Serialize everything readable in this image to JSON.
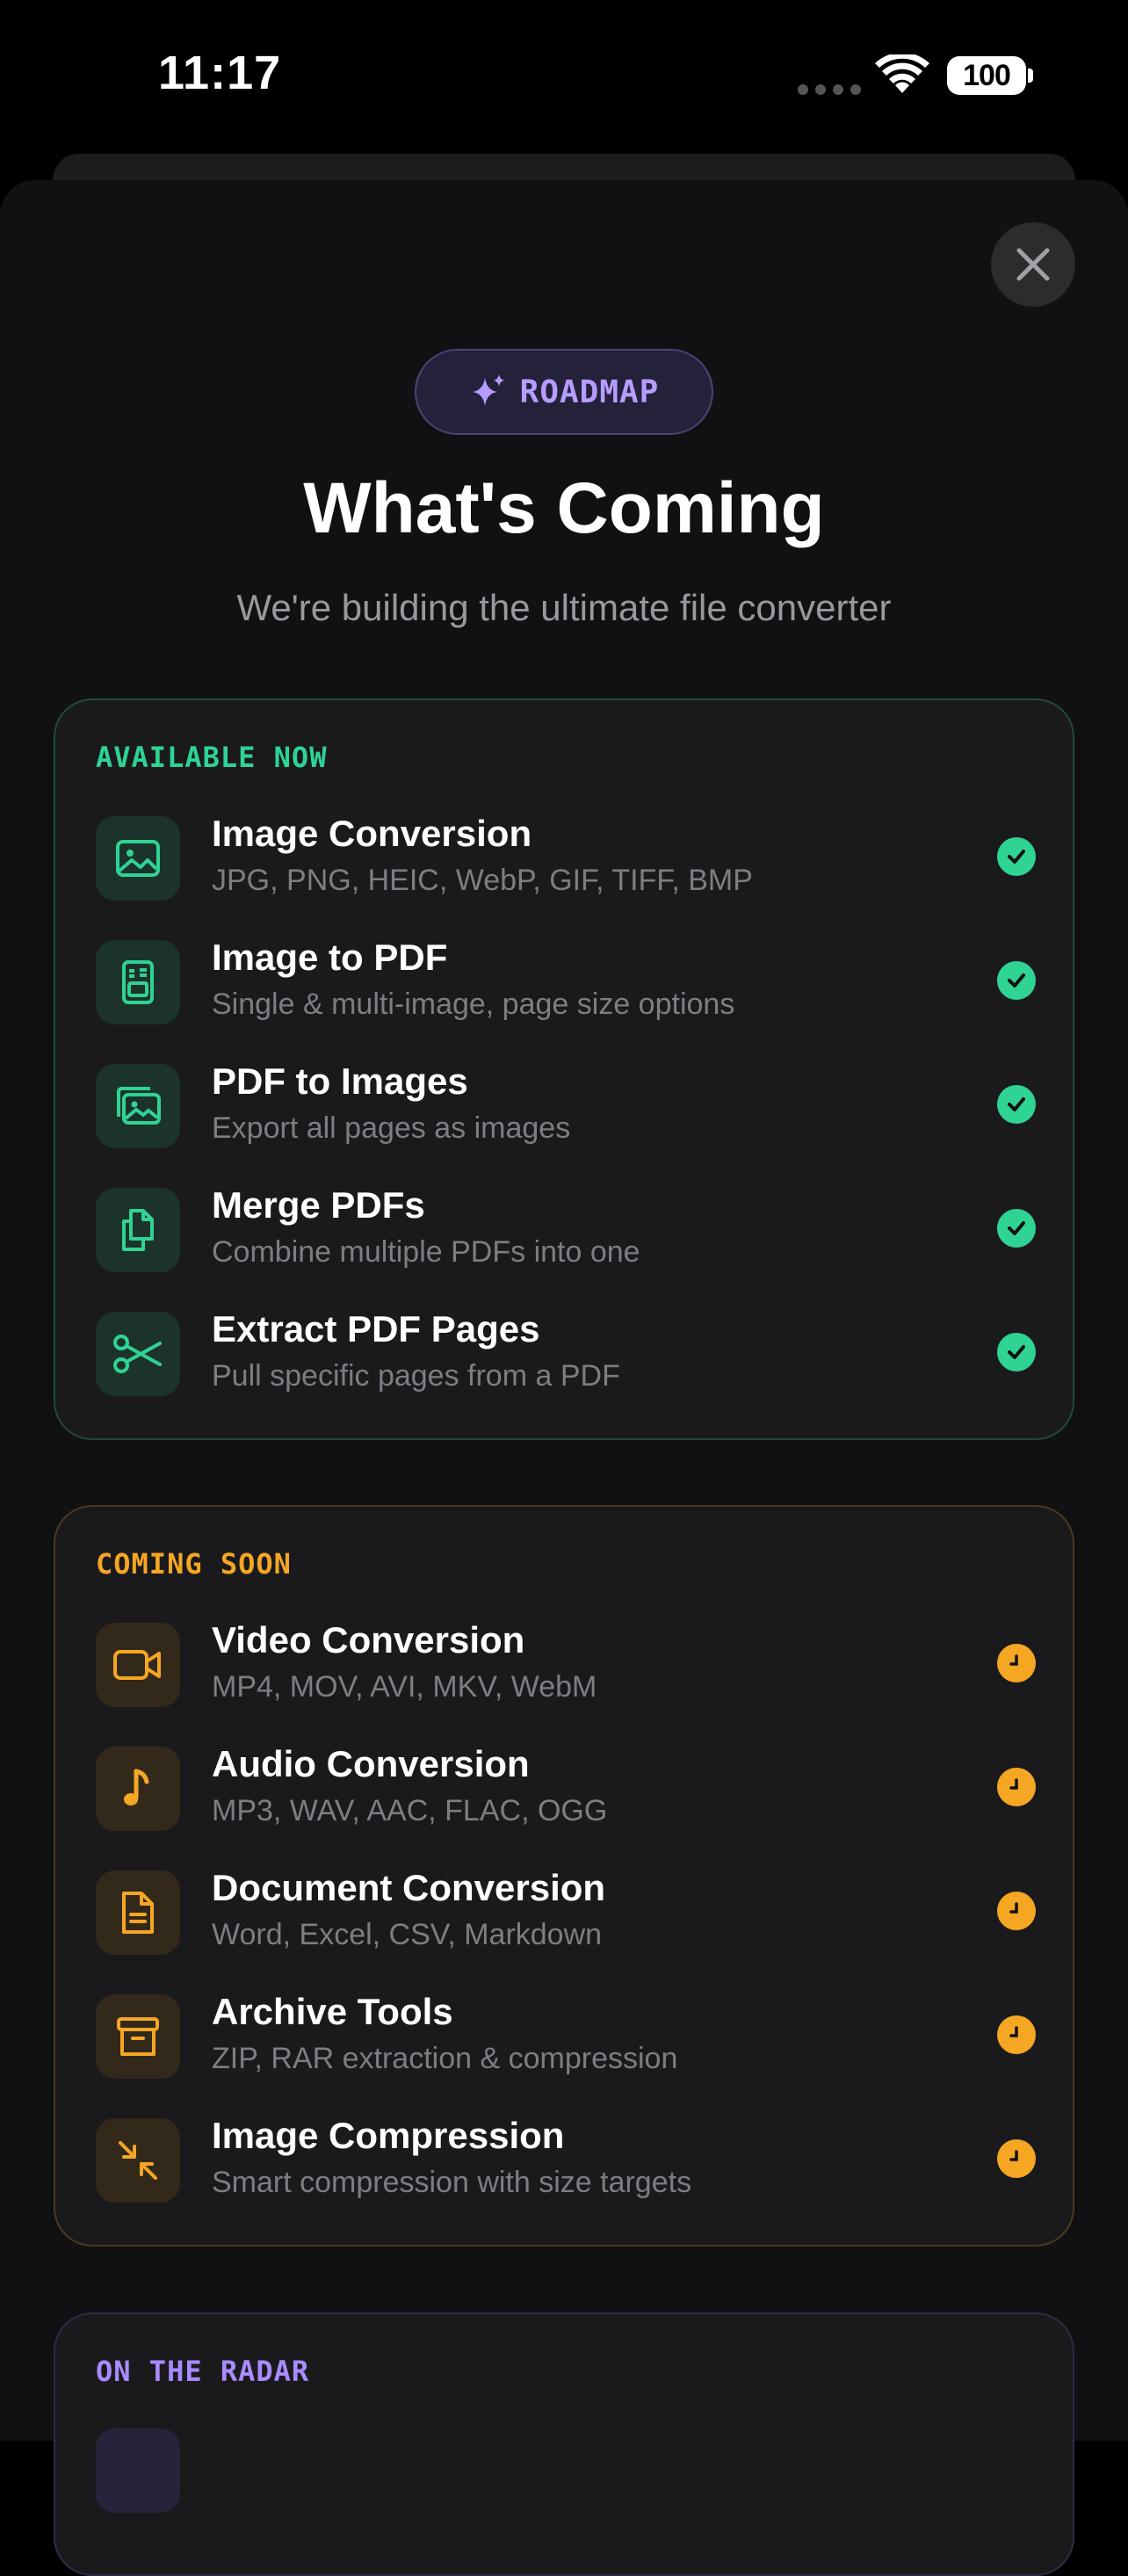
{
  "status_bar": {
    "time": "11:17",
    "battery": "100"
  },
  "badge": {
    "label": "ROADMAP",
    "icon": "sparkle-icon"
  },
  "header": {
    "title": "What's Coming",
    "subtitle": "We're building the ultimate file converter"
  },
  "colors": {
    "available": "#2fd393",
    "soon": "#f5a623",
    "radar": "#a98bff",
    "accent": "#b69cff"
  },
  "sections": {
    "available": {
      "label": "AVAILABLE NOW",
      "status_icon": "check-circle-icon",
      "items": [
        {
          "title": "Image Conversion",
          "subtitle": "JPG, PNG, HEIC, WebP, GIF, TIFF, BMP",
          "icon": "image-icon"
        },
        {
          "title": "Image to PDF",
          "subtitle": "Single & multi-image, page size options",
          "icon": "document-image-icon"
        },
        {
          "title": "PDF to Images",
          "subtitle": "Export all pages as images",
          "icon": "images-icon"
        },
        {
          "title": "Merge PDFs",
          "subtitle": "Combine multiple PDFs into one",
          "icon": "documents-icon"
        },
        {
          "title": "Extract PDF Pages",
          "subtitle": "Pull specific pages from a PDF",
          "icon": "scissors-icon"
        }
      ]
    },
    "soon": {
      "label": "COMING SOON",
      "status_icon": "clock-icon",
      "items": [
        {
          "title": "Video Conversion",
          "subtitle": "MP4, MOV, AVI, MKV, WebM",
          "icon": "video-icon"
        },
        {
          "title": "Audio Conversion",
          "subtitle": "MP3, WAV, AAC, FLAC, OGG",
          "icon": "music-note-icon"
        },
        {
          "title": "Document Conversion",
          "subtitle": "Word, Excel, CSV, Markdown",
          "icon": "document-text-icon"
        },
        {
          "title": "Archive Tools",
          "subtitle": "ZIP, RAR extraction & compression",
          "icon": "archive-box-icon"
        },
        {
          "title": "Image Compression",
          "subtitle": "Smart compression with size targets",
          "icon": "compress-arrows-icon"
        }
      ]
    },
    "radar": {
      "label": "ON THE RADAR"
    }
  }
}
